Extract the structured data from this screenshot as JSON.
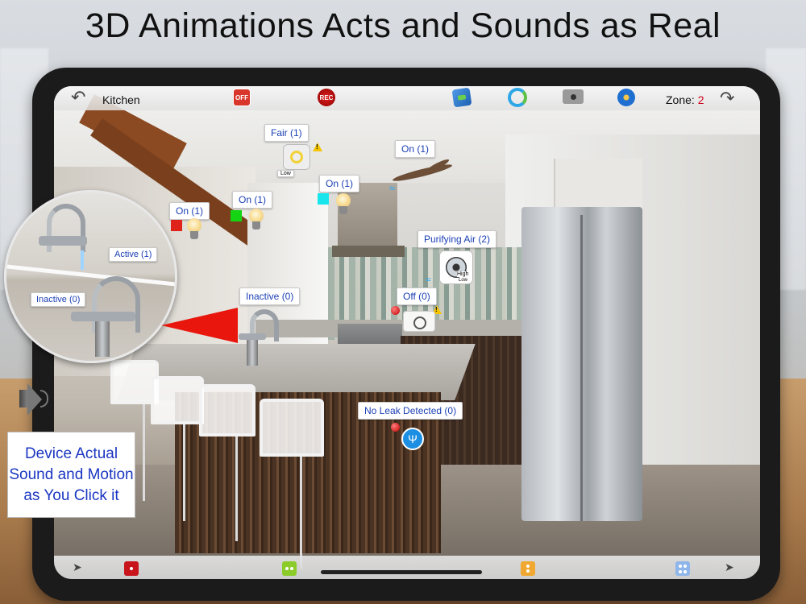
{
  "headline": "3D Animations Acts and Sounds as Real",
  "topbar": {
    "room": "Kitchen",
    "off_label": "OFF",
    "rec_label": "REC",
    "zone_label": "Zone:",
    "zone_number": "2"
  },
  "devices": {
    "fair_label": "Fair (1)",
    "fair_badge": "Low",
    "ceiling_fan_label": "On (1)",
    "pendant_label": "On (1)",
    "light_green_label": "On (1)",
    "light_red_label": "On (1)",
    "purifier_label": "Purifying Air (2)",
    "purifier_badge_high": "High",
    "purifier_badge_low": "Low",
    "faucet_label": "Inactive (0)",
    "plug_label": "Off (0)",
    "leak_label": "No Leak Detected (0)"
  },
  "magnifier": {
    "active_label": "Active (1)",
    "inactive_label": "Inactive (0)"
  },
  "caption": "Device Actual Sound and Motion as You Click it",
  "colors": {
    "label_text": "#1a3fb4",
    "caption_text": "#1a36c2",
    "zone_number": "#d0021b",
    "swatch_red": "#e0231a",
    "swatch_green": "#14d414",
    "swatch_cyan": "#18e6ec",
    "die_red": "#c8151b",
    "die_green": "#8ccc2a",
    "die_orange": "#f0a830",
    "die_blue": "#8fb6ea"
  },
  "icons": [
    "back-arrow-icon",
    "off-switch-icon",
    "record-icon",
    "photo-gallery-icon",
    "refresh-icon",
    "camera-icon",
    "settings-icon",
    "forward-arrow-icon",
    "speaker-icon"
  ]
}
